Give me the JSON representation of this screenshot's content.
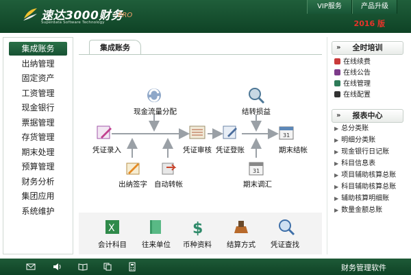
{
  "header": {
    "brand": "速达3000财务",
    "pro": "· PRO",
    "subtitle": "Superdata Software Technology",
    "top_buttons": [
      "VIP服务",
      "产品升级"
    ],
    "year": "2016 版"
  },
  "sidebar": {
    "items": [
      "集成账务",
      "出纳管理",
      "固定资产",
      "工资管理",
      "现金银行",
      "票据管理",
      "存货管理",
      "期末处理",
      "预算管理",
      "财务分析",
      "集团应用",
      "系统维护"
    ]
  },
  "center": {
    "tab": "集成账务",
    "flow": {
      "cash_flow": "现金流量分配",
      "voucher_entry": "凭证录入",
      "cashier_sign": "出纳签字",
      "auto_post": "自动转帐",
      "voucher_audit": "凭证审核",
      "voucher_post": "凭证登账",
      "carry_pl": "结转损益",
      "period_adjust": "期末调汇",
      "period_close": "期末结帐"
    },
    "tools": [
      "会计科目",
      "往来单位",
      "币种资料",
      "结算方式",
      "凭证查找"
    ]
  },
  "rightbar": {
    "training_title": "全时培训",
    "training_items": [
      "在线续费",
      "在线公告",
      "在线管理",
      "在线配置"
    ],
    "report_title": "报表中心",
    "report_items": [
      "总分类账",
      "明细分类账",
      "现金银行日记账",
      "科目信息表",
      "项目辅助核算总账",
      "科目辅助核算总账",
      "辅助核算明细账",
      "数量金额总账"
    ]
  },
  "footer": {
    "text": "财务管理软件",
    "icons": [
      "mail-icon",
      "speaker-icon",
      "book-icon",
      "copy-icon",
      "calculator-icon"
    ]
  },
  "colors": {
    "header_green": "#1f5e3a",
    "year_red": "#e8332a",
    "flow_gray": "#9aa0a6"
  }
}
